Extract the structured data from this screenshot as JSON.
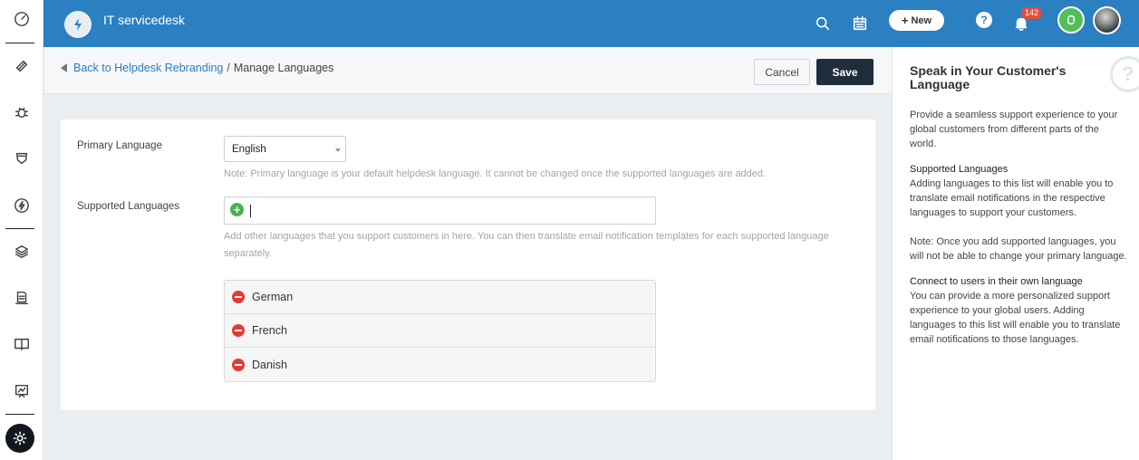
{
  "app": {
    "title": "IT servicedesk"
  },
  "topbar": {
    "new_label": "New",
    "help_label": "?",
    "notification_count": "142"
  },
  "leftnav": {
    "icons": [
      "dashboard-icon",
      "tickets-icon",
      "problems-icon",
      "changes-icon",
      "releases-icon",
      "assets-icon",
      "catalog-icon",
      "solutions-icon",
      "reports-icon",
      "admin-icon"
    ]
  },
  "breadcrumb": {
    "back_link": "Back to Helpdesk Rebranding",
    "separator": "/",
    "current": "Manage Languages"
  },
  "actions": {
    "cancel": "Cancel",
    "save": "Save"
  },
  "form": {
    "primary_label": "Primary Language",
    "primary_value": "English",
    "primary_note": "Note: Primary language is your default helpdesk language. It cannot be changed once the supported languages are added.",
    "supported_label": "Supported Languages",
    "supported_note": "Add other languages that you support customers in here. You can then translate email notification templates for each supported language separately.",
    "languages": [
      "German",
      "French",
      "Danish"
    ]
  },
  "sidebar": {
    "title": "Speak in Your Customer's Language",
    "intro": "Provide a seamless support experience to your global customers from different parts of the world.",
    "sec1_title": "Supported Languages",
    "sec1_body": "Adding languages to this list will enable you to translate email notifications in the respective languages to support your customers.",
    "sec1_note": "Note: Once you add supported languages, you will not be able to change your primary language.",
    "sec2_title": "Connect to users in their own language",
    "sec2_body": "You can provide a more personalized support experience to your global users. Adding languages to this list will enable you to translate email notifications to those languages."
  },
  "colors": {
    "topbar": "#2b80c1",
    "save_button": "#1f2d3d",
    "link": "#2c7dbf",
    "add": "#4caf50",
    "remove": "#e53935",
    "badge": "#e74c3c"
  }
}
